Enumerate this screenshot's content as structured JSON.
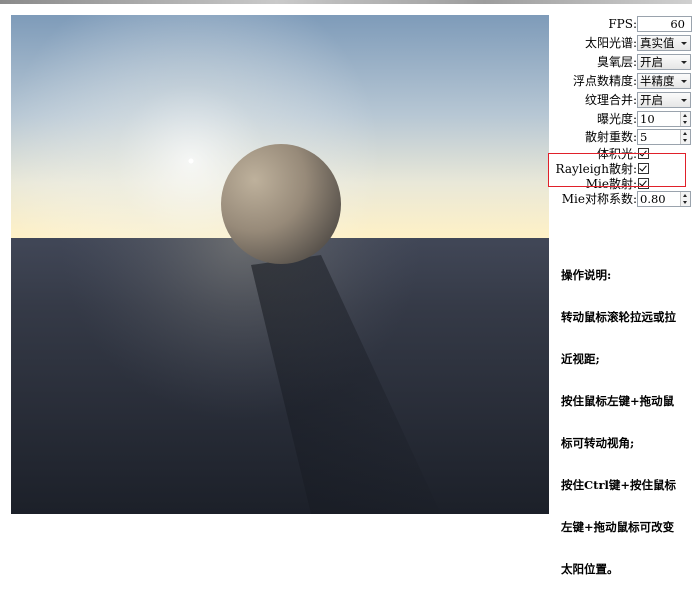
{
  "viewport": {
    "colors": {
      "sky_top": "#8aa4be",
      "sky_horizon": "#fdf0c8",
      "ground_top": "#3c4150",
      "ground_bottom": "#1d222b",
      "sphere_light": "#b8aa96",
      "sphere_dark": "#575049",
      "sun": "#ffffff"
    }
  },
  "controls": {
    "fps": {
      "label": "FPS:",
      "value": "60"
    },
    "solar_spectrum": {
      "label": "太阳光谱:",
      "value": "真实值"
    },
    "ozone": {
      "label": "臭氧层:",
      "value": "开启"
    },
    "float_precision": {
      "label": "浮点数精度:",
      "value": "半精度"
    },
    "texture_merge": {
      "label": "纹理合并:",
      "value": "开启"
    },
    "exposure": {
      "label": "曝光度:",
      "value": "10"
    },
    "scatter_count": {
      "label": "散射重数:",
      "value": "5"
    },
    "volumetric_light": {
      "label": "体积光:",
      "checked": true
    },
    "rayleigh_scatter": {
      "label": "Rayleigh散射:",
      "checked": true
    },
    "mie_scatter": {
      "label": "Mie散射:",
      "checked": true
    },
    "mie_symmetry": {
      "label": "Mie对称系数:",
      "value": "0.80"
    }
  },
  "instructions": {
    "title": "操作说明:",
    "lines": [
      "转动鼠标滚轮拉远或拉",
      "近视距;",
      "按住鼠标左键+拖动鼠",
      "标可转动视角;",
      "按住Ctrl键+按住鼠标",
      "左键+拖动鼠标可改变",
      "太阳位置。"
    ]
  },
  "highlight_color": "#e0202a"
}
